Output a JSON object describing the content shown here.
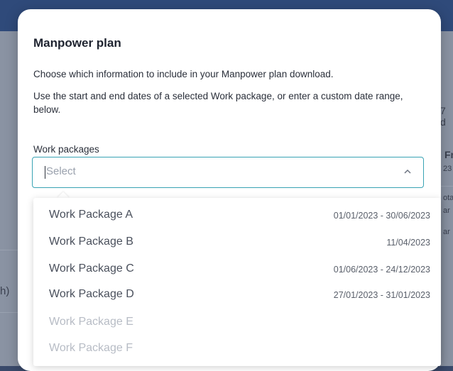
{
  "modal": {
    "title": "Manpower plan",
    "description_1": "Choose which information to include in your Manpower plan download.",
    "description_2": "Use the start and end dates of a selected Work package, or enter a custom date range, below.",
    "field_label": "Work packages",
    "select_placeholder": "Select"
  },
  "work_packages": [
    {
      "name": "Work Package A",
      "dates": "01/01/2023 - 30/06/2023",
      "disabled": false
    },
    {
      "name": "Work Package B",
      "dates": "11/04/2023",
      "disabled": false
    },
    {
      "name": "Work Package C",
      "dates": "01/06/2023 - 24/12/2023",
      "disabled": false
    },
    {
      "name": "Work Package D",
      "dates": "27/01/2023 - 31/01/2023",
      "disabled": false
    },
    {
      "name": "Work Package E",
      "dates": "",
      "disabled": true
    },
    {
      "name": "Work Package F",
      "dates": "",
      "disabled": true
    }
  ],
  "background": {
    "frag_days": "7 d",
    "frag_fri": "Fri",
    "frag_23": "23",
    "frag_ota": "ota",
    "frag_ar": "ar",
    "frag_paren": "h)"
  },
  "icons": {
    "chevron": "chevron-up-icon"
  },
  "colors": {
    "accent_border": "#39a3b4",
    "overlay": "#8a93a3"
  }
}
